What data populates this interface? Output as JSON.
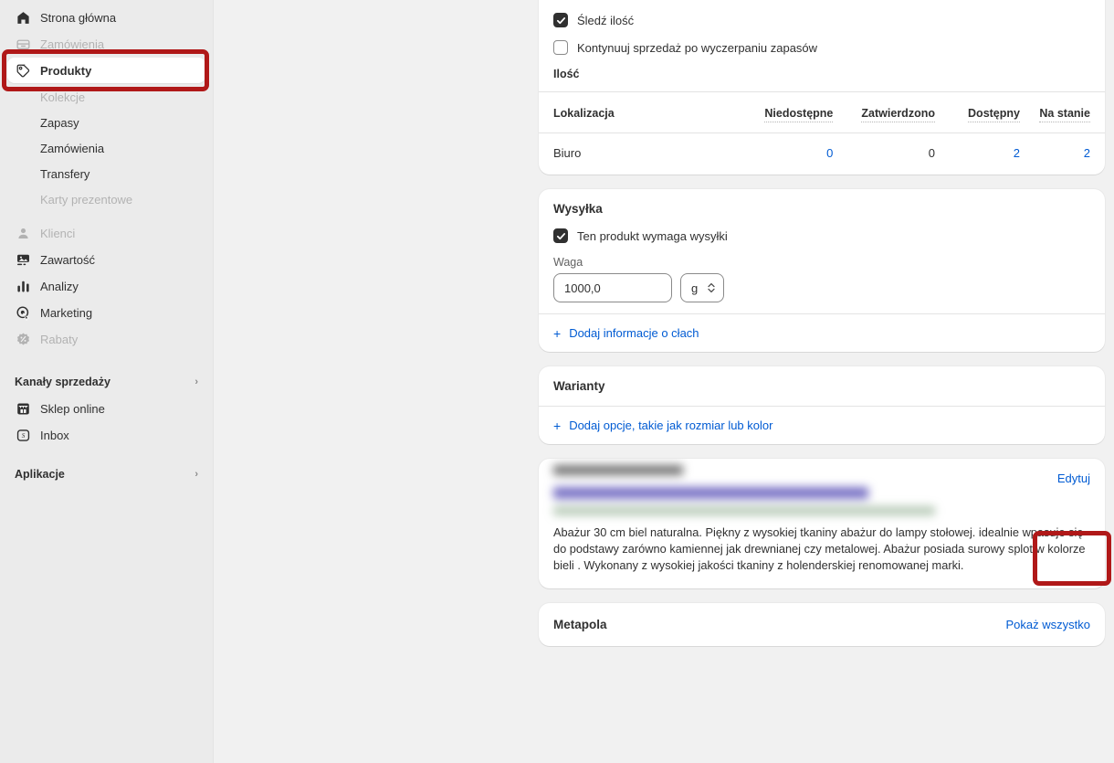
{
  "sidebar": {
    "items": [
      {
        "label": "Strona główna",
        "icon": "home-icon",
        "state": "normal",
        "level": "top"
      },
      {
        "label": "Zamówienia",
        "icon": "orders-icon",
        "state": "faded",
        "level": "top"
      },
      {
        "label": "Produkty",
        "icon": "tag-icon",
        "state": "active",
        "level": "top"
      },
      {
        "label": "Kolekcje",
        "icon": "",
        "state": "sub-faded",
        "level": "sub"
      },
      {
        "label": "Zapasy",
        "icon": "",
        "state": "sub",
        "level": "sub"
      },
      {
        "label": "Zamówienia",
        "icon": "",
        "state": "sub",
        "level": "sub"
      },
      {
        "label": "Transfery",
        "icon": "",
        "state": "sub",
        "level": "sub"
      },
      {
        "label": "Karty prezentowe",
        "icon": "",
        "state": "sub-faded",
        "level": "sub"
      },
      {
        "label": "Klienci",
        "icon": "person-icon",
        "state": "faded",
        "level": "top"
      },
      {
        "label": "Zawartość",
        "icon": "content-icon",
        "state": "normal",
        "level": "top"
      },
      {
        "label": "Analizy",
        "icon": "analytics-icon",
        "state": "normal",
        "level": "top"
      },
      {
        "label": "Marketing",
        "icon": "marketing-icon",
        "state": "normal",
        "level": "top"
      },
      {
        "label": "Rabaty",
        "icon": "discount-icon",
        "state": "faded",
        "level": "top"
      }
    ],
    "sales_channels": {
      "label": "Kanały sprzedaży",
      "chevron": "›"
    },
    "channels": [
      {
        "label": "Sklep online",
        "icon": "storefront-icon"
      },
      {
        "label": "Inbox",
        "icon": "inbox-icon"
      }
    ],
    "apps": {
      "label": "Aplikacje",
      "chevron": "›"
    }
  },
  "inventory": {
    "track_quantity_label": "Śledź ilość",
    "track_quantity_checked": "checked",
    "continue_selling_label": "Kontynuuj sprzedaż po wyczerpaniu zapasów",
    "continue_selling_checked": "unchecked",
    "quantity_label": "Ilość",
    "columns": [
      "Lokalizacja",
      "Niedostępne",
      "Zatwierdzono",
      "Dostępny",
      "Na stanie"
    ],
    "rows": [
      {
        "location": "Biuro",
        "unavailable": "0",
        "committed": "0",
        "available": "2",
        "on_hand": "2"
      }
    ]
  },
  "shipping": {
    "title": "Wysyłka",
    "requires_shipping_label": "Ten produkt wymaga wysyłki",
    "requires_shipping_checked": "checked",
    "weight_label": "Waga",
    "weight_value": "1000,0",
    "weight_unit": "g",
    "customs_link": "Dodaj informacje o cłach",
    "plus": "+"
  },
  "variants": {
    "title": "Warianty",
    "add_options_link": "Dodaj opcje, takie jak rozmiar lub kolor",
    "plus": "+"
  },
  "seo": {
    "edit_label": "Edytuj",
    "description": "Abażur 30 cm biel naturalna. Piękny z wysokiej tkaniny abażur do lampy stołowej. idealnie wpasuje się do podstawy zarówno kamiennej jak drewnianej czy metalowej. Abażur posiada surowy splot w kolorze bieli . Wykonany z wysokiej jakości tkaniny z holenderskiej renomowanej marki."
  },
  "metafields": {
    "title": "Metapola",
    "show_all_link": "Pokaż wszystko"
  },
  "colors": {
    "accent_link": "#005bd3",
    "annotation_red": "#b01818",
    "text": "#303030",
    "sidebar_bg": "#ebebeb",
    "page_bg": "#f1f1f1"
  }
}
